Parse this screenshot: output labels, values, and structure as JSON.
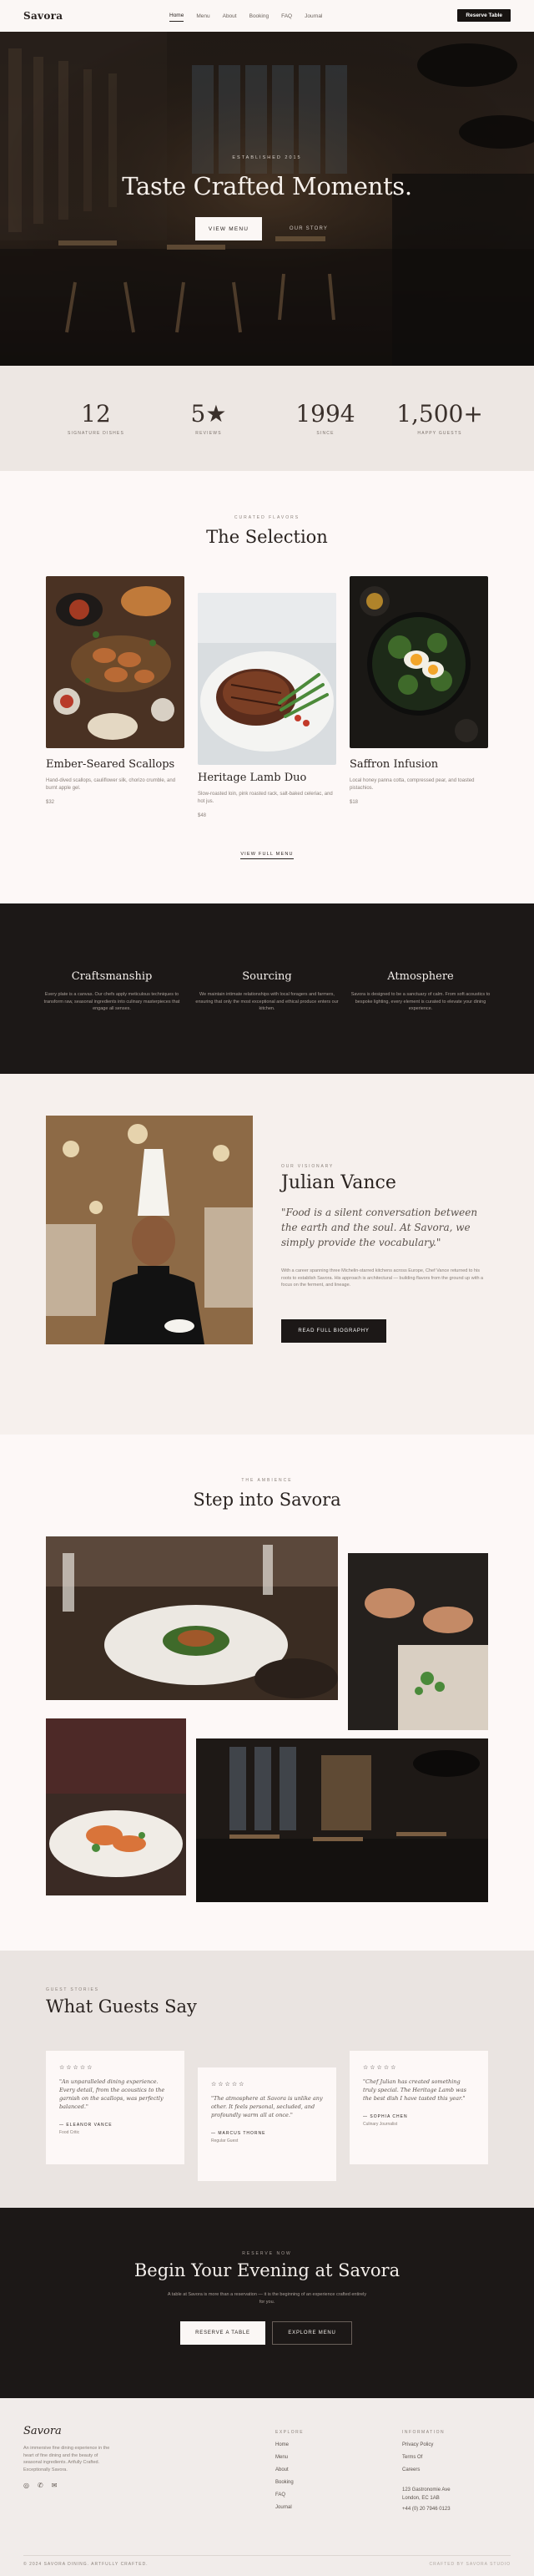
{
  "nav": {
    "logo": "Savora",
    "links": [
      "Home",
      "Menu",
      "About",
      "Booking",
      "FAQ",
      "Journal"
    ],
    "reserve": "Reserve Table"
  },
  "hero": {
    "eyebrow": "ESTABLISHED 2015",
    "title": "Taste Crafted Moments.",
    "primary": "VIEW MENU",
    "secondary": "OUR STORY"
  },
  "stats": [
    {
      "value": "12",
      "label": "SIGNATURE DISHES"
    },
    {
      "value": "5★",
      "label": "REVIEWS"
    },
    {
      "value": "1994",
      "label": "SINCE"
    },
    {
      "value": "1,500+",
      "label": "HAPPY GUESTS"
    }
  ],
  "selection": {
    "eyebrow": "CURATED FLAVORS",
    "title": "The Selection",
    "dishes": [
      {
        "name": "Ember-Seared Scallops",
        "desc": "Hand-dived scallops, cauliflower silk, chorizo crumble, and burnt apple gel.",
        "price": "$32"
      },
      {
        "name": "Heritage Lamb Duo",
        "desc": "Slow-roasted loin, pink roasted rack, salt-baked celeriac, and hot jus.",
        "price": "$48"
      },
      {
        "name": "Saffron Infusion",
        "desc": "Local honey panna cotta, compressed pear, and toasted pistachios.",
        "price": "$18"
      }
    ],
    "view_all": "VIEW FULL MENU"
  },
  "philosophy": [
    {
      "title": "Craftsmanship",
      "text": "Every plate is a canvas. Our chefs apply meticulous techniques to transform raw, seasonal ingredients into culinary masterpieces that engage all senses."
    },
    {
      "title": "Sourcing",
      "text": "We maintain intimate relationships with local foragers and farmers, ensuring that only the most exceptional and ethical produce enters our kitchen."
    },
    {
      "title": "Atmosphere",
      "text": "Savora is designed to be a sanctuary of calm. From soft acoustics to bespoke lighting, every element is curated to elevate your dining experience."
    }
  ],
  "chef": {
    "eyebrow": "OUR VISIONARY",
    "name": "Julian Vance",
    "quote": "\"Food is a silent conversation between the earth and the soul. At Savora, we simply provide the vocabulary.\"",
    "bio": "With a career spanning three Michelin-starred kitchens across Europe, Chef Vance returned to his roots to establish Savora. His approach is architectural — building flavors from the ground up with a focus on the ferment, and lineage.",
    "button": "READ FULL BIOGRAPHY"
  },
  "gallery": {
    "eyebrow": "THE AMBIENCE",
    "title": "Step into Savora"
  },
  "testimonials": {
    "eyebrow": "GUEST STORIES",
    "title": "What Guests Say",
    "items": [
      {
        "stars": "☆☆☆☆☆",
        "quote": "\"An unparalleled dining experience. Every detail, from the acoustics to the garnish on the scallops, was perfectly balanced.\"",
        "name": "— ELEANOR VANCE",
        "role": "Food Critic"
      },
      {
        "stars": "☆☆☆☆☆",
        "quote": "\"The atmosphere at Savora is unlike any other. It feels personal, secluded, and profoundly warm all at once.\"",
        "name": "— MARCUS THORNE",
        "role": "Regular Guest"
      },
      {
        "stars": "☆☆☆☆☆",
        "quote": "\"Chef Julian has created something truly special. The Heritage Lamb was the best dish I have tasted this year.\"",
        "name": "— SOPHIA CHEN",
        "role": "Culinary Journalist"
      }
    ]
  },
  "cta": {
    "eyebrow": "RESERVE NOW",
    "title": "Begin Your Evening at Savora",
    "text": "A table at Savora is more than a reservation — it is the beginning of an experience crafted entirely for you.",
    "primary": "RESERVE A TABLE",
    "secondary": "EXPLORE MENU"
  },
  "footer": {
    "logo": "Savora",
    "about": "An immersive fine dining experience in the heart of fine dining and the beauty of seasonal ingredients. Artfully Crafted. Exceptionally Savora.",
    "explore_heading": "EXPLORE",
    "explore": [
      "Home",
      "Menu",
      "About",
      "Booking",
      "FAQ",
      "Journal"
    ],
    "info_heading": "INFORMATION",
    "info": [
      "Privacy Policy",
      "Terms Of",
      "Careers"
    ],
    "address": [
      "123 Gastronomie Ave",
      "London, EC 1AB"
    ],
    "phone": "+44 (0) 20 7946 0123",
    "copyright": "© 2024 SAVORA DINING. ARTFULLY CRAFTED.",
    "credit": "CRAFTED BY SAVORA STUDIO"
  }
}
